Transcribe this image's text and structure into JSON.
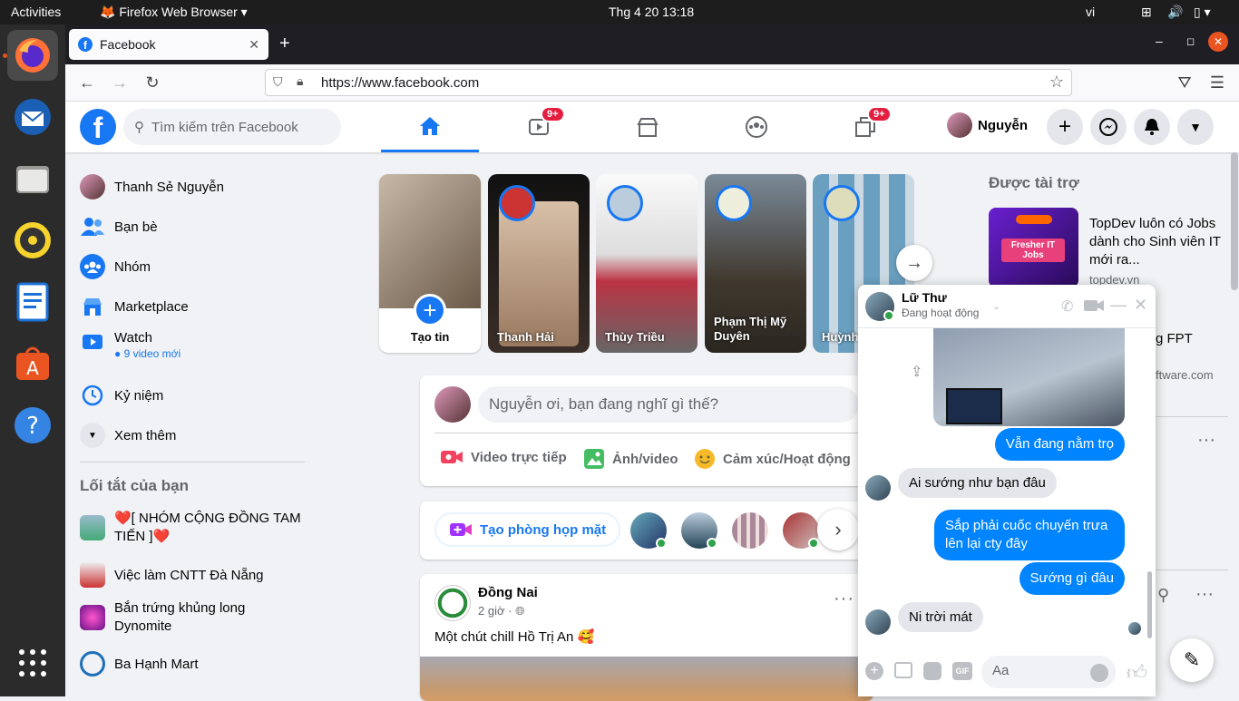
{
  "system": {
    "activities": "Activities",
    "app_menu": "Firefox Web Browser",
    "clock": "Thg 4 20  13:18",
    "lang": "vi"
  },
  "browser": {
    "tab_title": "Facebook",
    "url": "https://www.facebook.com"
  },
  "header": {
    "search_placeholder": "Tìm kiếm trên Facebook",
    "watch_badge": "9+",
    "gaming_badge": "9+",
    "profile_name": "Nguyễn"
  },
  "sidebar": {
    "items": [
      {
        "label": "Thanh Sẻ Nguyễn"
      },
      {
        "label": "Bạn bè"
      },
      {
        "label": "Nhóm"
      },
      {
        "label": "Marketplace"
      },
      {
        "label": "Watch",
        "sub": "9 video mới"
      },
      {
        "label": "Kỷ niệm"
      },
      {
        "label": "Xem thêm"
      }
    ],
    "shortcuts_title": "Lối tắt của bạn",
    "shortcuts": [
      {
        "label": "❤️[ NHÓM CỘNG ĐỒNG TAM TIẾN ]❤️"
      },
      {
        "label": "Việc làm CNTT Đà Nẵng"
      },
      {
        "label": "Bắn trứng khủng long Dynomite"
      },
      {
        "label": "Ba Hạnh Mart"
      }
    ]
  },
  "stories": [
    {
      "name": "Tạo tin"
    },
    {
      "name": "Thanh Hải"
    },
    {
      "name": "Thùy Triều"
    },
    {
      "name": "Phạm Thị Mỹ Duyên"
    },
    {
      "name": "Huỳnh"
    }
  ],
  "composer": {
    "placeholder": "Nguyễn ơi, bạn đang nghĩ gì thế?",
    "live": "Video trực tiếp",
    "photo": "Ảnh/video",
    "feeling": "Cảm xúc/Hoạt động"
  },
  "rooms": {
    "create": "Tạo phòng họp mặt"
  },
  "post": {
    "author": "Đồng Nai",
    "time": "2 giờ ·",
    "text": "Một chút chill Hồ Trị An 🥰"
  },
  "right": {
    "sponsored_title": "Được tài trợ",
    "ad1_text": "TopDev luôn có Jobs dành cho Sinh viên IT mới ra...",
    "ad1_domain": "topdev.vn",
    "ad1_img_title": "Fresher IT Jobs",
    "ad2_text_partial": "g FPT",
    "ad2_domain_partial": "ftware.com"
  },
  "chat": {
    "name": "Lữ Thư",
    "status": "Đang hoạt động",
    "messages": [
      {
        "from": "me",
        "text": "Vẫn đang nằm trọ"
      },
      {
        "from": "them",
        "text": "Ai sướng như bạn đâu"
      },
      {
        "from": "me",
        "text": "Sắp phải cuốc chuyến trưa lên lại cty đây"
      },
      {
        "from": "me",
        "text": "Sướng gì đâu"
      },
      {
        "from": "them",
        "text": "Ni trời mát"
      }
    ],
    "input_placeholder": "Aa"
  },
  "colors": {
    "fb_blue": "#1877f2",
    "messenger_blue": "#0084ff",
    "badge_red": "#e41e3f"
  }
}
